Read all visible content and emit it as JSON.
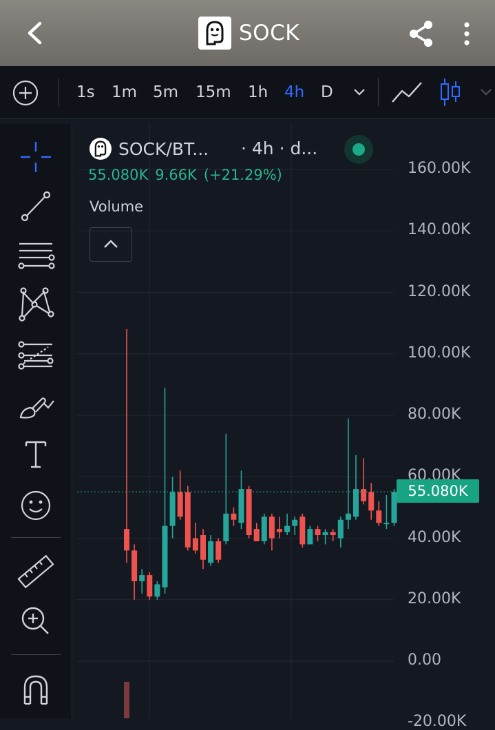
{
  "header": {
    "title": "SOCK",
    "back_icon": "chevron-left-icon",
    "share_icon": "share-icon",
    "more_icon": "more-vertical-icon"
  },
  "toolbar": {
    "add_icon": "plus-circle-icon",
    "intervals": [
      "1s",
      "1m",
      "5m",
      "15m",
      "1h",
      "4h",
      "D"
    ],
    "active_interval": "4h",
    "dropdown_icon": "chevron-down-icon",
    "line_chart_icon": "line-chart-icon",
    "candle_chart_icon": "candlestick-icon",
    "active_color": "#2f6bff"
  },
  "drawing_tools": [
    "crosshair-icon",
    "trend-line-icon",
    "horizontal-lines-icon",
    "pattern-icon",
    "fib-icon",
    "brush-icon",
    "text-icon",
    "emoji-icon",
    "ruler-icon",
    "zoom-in-icon",
    "magnet-icon"
  ],
  "chart": {
    "symbol": "SOCK/BT...",
    "interval_text": "· 4h · d...",
    "ohlc": {
      "last": "55.080K",
      "change": "9.66K",
      "change_pct": "(+21.29%)"
    },
    "volume_label": "Volume",
    "collapse_icon": "chevron-up-icon",
    "price_tag": "55.080K",
    "up_color": "#26a69a",
    "down_color": "#ef5350"
  },
  "chart_data": {
    "type": "candlestick",
    "y_tick_labels": [
      "160.00K",
      "140.00K",
      "120.00K",
      "100.00K",
      "80.00K",
      "60.00K",
      "40.00K",
      "20.00K",
      "0.00",
      "-20.00K"
    ],
    "ylim": [
      -22000,
      166000
    ],
    "last_price": 55080,
    "candles": [
      {
        "o": 43000,
        "h": 108000,
        "l": 32000,
        "c": 36000
      },
      {
        "o": 36000,
        "h": 38000,
        "l": 20000,
        "c": 26000
      },
      {
        "o": 26000,
        "h": 30000,
        "l": 22000,
        "c": 28000
      },
      {
        "o": 28000,
        "h": 29000,
        "l": 20000,
        "c": 21000
      },
      {
        "o": 21000,
        "h": 26000,
        "l": 20000,
        "c": 25000
      },
      {
        "o": 24000,
        "h": 89000,
        "l": 22000,
        "c": 44000
      },
      {
        "o": 44000,
        "h": 60000,
        "l": 40000,
        "c": 55000
      },
      {
        "o": 55000,
        "h": 62000,
        "l": 46000,
        "c": 47000
      },
      {
        "o": 55000,
        "h": 57000,
        "l": 36000,
        "c": 37000
      },
      {
        "o": 40000,
        "h": 45000,
        "l": 35000,
        "c": 36000
      },
      {
        "o": 41000,
        "h": 43000,
        "l": 30000,
        "c": 33000
      },
      {
        "o": 32000,
        "h": 41000,
        "l": 31000,
        "c": 39000
      },
      {
        "o": 39000,
        "h": 40000,
        "l": 32000,
        "c": 33000
      },
      {
        "o": 39000,
        "h": 74000,
        "l": 38000,
        "c": 48000
      },
      {
        "o": 48000,
        "h": 50000,
        "l": 44000,
        "c": 46000
      },
      {
        "o": 45000,
        "h": 62000,
        "l": 43000,
        "c": 56000
      },
      {
        "o": 56000,
        "h": 57000,
        "l": 40000,
        "c": 41000
      },
      {
        "o": 43000,
        "h": 45000,
        "l": 39000,
        "c": 39000
      },
      {
        "o": 39000,
        "h": 48000,
        "l": 38000,
        "c": 47000
      },
      {
        "o": 47000,
        "h": 48000,
        "l": 36000,
        "c": 40000
      },
      {
        "o": 43000,
        "h": 47000,
        "l": 40000,
        "c": 42000
      },
      {
        "o": 42000,
        "h": 48000,
        "l": 41000,
        "c": 44000
      },
      {
        "o": 44000,
        "h": 47000,
        "l": 41000,
        "c": 46000
      },
      {
        "o": 47000,
        "h": 48000,
        "l": 37000,
        "c": 38000
      },
      {
        "o": 38000,
        "h": 44000,
        "l": 38000,
        "c": 43000
      },
      {
        "o": 43000,
        "h": 44000,
        "l": 39000,
        "c": 41000
      },
      {
        "o": 41000,
        "h": 43000,
        "l": 38000,
        "c": 42000
      },
      {
        "o": 42000,
        "h": 43000,
        "l": 39000,
        "c": 41000
      },
      {
        "o": 40000,
        "h": 47000,
        "l": 37000,
        "c": 46000
      },
      {
        "o": 46000,
        "h": 79000,
        "l": 43000,
        "c": 48000
      },
      {
        "o": 47000,
        "h": 67000,
        "l": 46000,
        "c": 56000
      },
      {
        "o": 56000,
        "h": 66000,
        "l": 51000,
        "c": 52000
      },
      {
        "o": 55000,
        "h": 58000,
        "l": 46000,
        "c": 49000
      },
      {
        "o": 49000,
        "h": 52000,
        "l": 44000,
        "c": 45000
      },
      {
        "o": 45000,
        "h": 54000,
        "l": 43000,
        "c": 45000
      },
      {
        "o": 45000,
        "h": 56000,
        "l": 44000,
        "c": 55080
      }
    ],
    "volume": [
      {
        "value": 1,
        "up": false
      }
    ]
  }
}
